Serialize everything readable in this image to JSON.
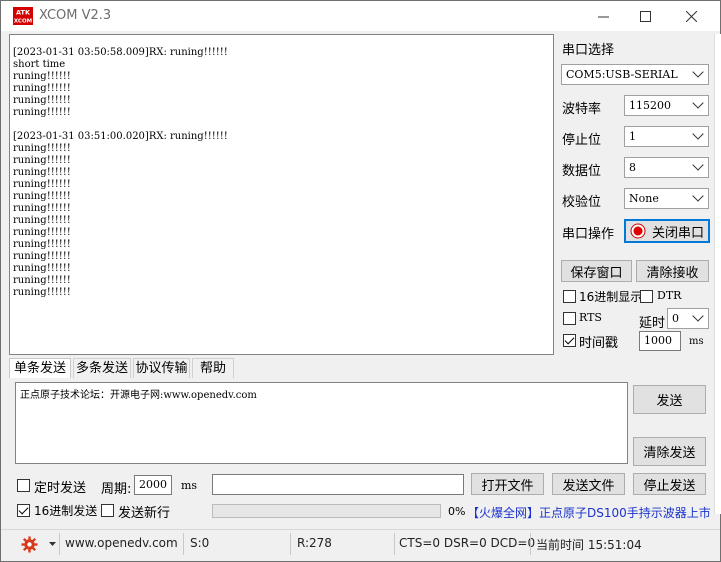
{
  "window": {
    "title": "XCOM V2.3",
    "logo_top": "ATK",
    "logo_bottom": "XCOM"
  },
  "receive": {
    "lines": "[2023-01-31 03:50:58.009]RX: runing!!!!!!\nshort time\nruning!!!!!!\nruning!!!!!!\nruning!!!!!!\nruning!!!!!!\n\n[2023-01-31 03:51:00.020]RX: runing!!!!!!\nruning!!!!!!\nruning!!!!!!\nruning!!!!!!\nruning!!!!!!\nruning!!!!!!\nruning!!!!!!\nruning!!!!!!\nruning!!!!!!\nruning!!!!!!\nruning!!!!!!\nruning!!!!!!\nruning!!!!!!\nruning!!!!!!"
  },
  "settings": {
    "port_label": "串口选择",
    "port_value": "COM5:USB-SERIAL",
    "baud_label": "波特率",
    "baud_value": "115200",
    "stop_label": "停止位",
    "stop_value": "1",
    "data_label": "数据位",
    "data_value": "8",
    "parity_label": "校验位",
    "parity_value": "None",
    "op_label": "串口操作",
    "op_button": "关闭串口",
    "op_state_color": "#e00000"
  },
  "rx_opts": {
    "save_window": "保存窗口",
    "clear_receive": "清除接收",
    "hex_display": "16进制显示",
    "dtr": "DTR",
    "rts": "RTS",
    "delay_label": "延时",
    "delay_value": "0",
    "timestamp_label": "时间戳",
    "timestamp_value": "1000",
    "timestamp_unit": "ms"
  },
  "tabs": [
    "单条发送",
    "多条发送",
    "协议传输",
    "帮助"
  ],
  "send": {
    "text": "正点原子技术论坛：开源电子网:www.openedv.com",
    "send_button": "发送",
    "clear_send_button": "清除发送",
    "timed_send": "定时发送",
    "period_label": "周期:",
    "period_value": "2000",
    "period_unit": "ms",
    "open_file": "打开文件",
    "send_file": "发送文件",
    "stop_send": "停止发送",
    "hex_send": "16进制发送",
    "newline_send": "发送新行",
    "progress_percent": "0%",
    "progress_fraction": 0,
    "ad_text": "【火爆全网】正点原子DS100手持示波器上市"
  },
  "status": {
    "url": "www.openedv.com",
    "sent": "S:0",
    "received": "R:278",
    "lines": "CTS=0 DSR=0 DCD=0",
    "time": "当前时间 15:51:04"
  }
}
